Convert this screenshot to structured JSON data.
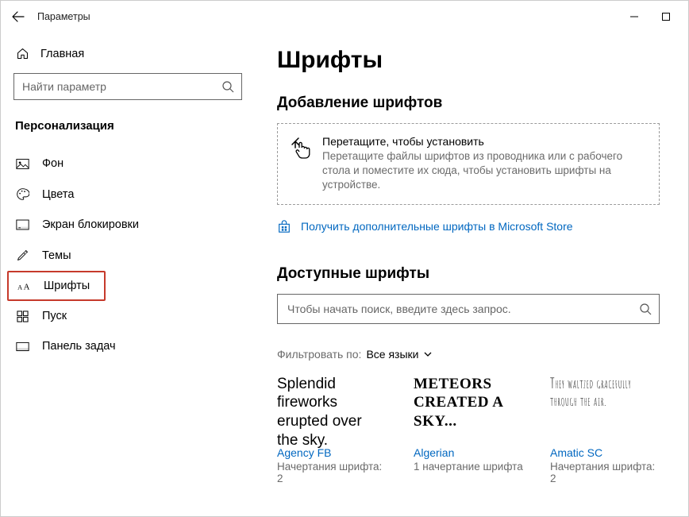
{
  "titlebar": {
    "title": "Параметры"
  },
  "sidebar": {
    "home": "Главная",
    "search_placeholder": "Найти параметр",
    "section": "Персонализация",
    "items": [
      {
        "label": "Фон"
      },
      {
        "label": "Цвета"
      },
      {
        "label": "Экран блокировки"
      },
      {
        "label": "Темы"
      },
      {
        "label": "Шрифты"
      },
      {
        "label": "Пуск"
      },
      {
        "label": "Панель задач"
      }
    ]
  },
  "page": {
    "title": "Шрифты",
    "add_heading": "Добавление шрифтов",
    "drop_title": "Перетащите, чтобы установить",
    "drop_body": "Перетащите файлы шрифтов из проводника или с рабочего стола и поместите их сюда, чтобы установить шрифты на устройстве.",
    "store_link": "Получить дополнительные шрифты в Microsoft Store",
    "available_heading": "Доступные шрифты",
    "font_search_placeholder": "Чтобы начать поиск, введите здесь запрос.",
    "filter_label": "Фильтровать по:",
    "filter_value": "Все языки",
    "fonts": [
      {
        "preview": "Splendid fireworks erupted over the sky.",
        "name": "Agency FB",
        "meta": "Начертания шрифта: 2"
      },
      {
        "preview": "METEORS CREATED A SKY...",
        "name": "Algerian",
        "meta": "1 начертание шрифта"
      },
      {
        "preview": "They waltzed gracefully through the air.",
        "name": "Amatic SC",
        "meta": "Начертания шрифта: 2"
      }
    ]
  }
}
